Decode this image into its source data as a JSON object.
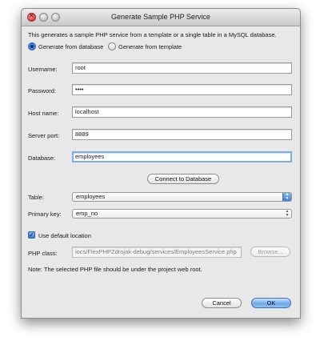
{
  "window": {
    "title": "Generate Sample PHP Service"
  },
  "description": "This generates a sample PHP service from a template or a single table in a MySQL database.",
  "mode": {
    "from_database_label": "Generate from database",
    "from_template_label": "Generate from template",
    "selected": "from_database"
  },
  "form": {
    "username_label": "Username:",
    "username_value": "root",
    "password_label": "Password:",
    "password_value": "••••",
    "host_label": "Host name:",
    "host_value": "localhost",
    "port_label": "Server port:",
    "port_value": "8889",
    "database_label": "Database:",
    "database_value": "employees"
  },
  "connect_button": "Connect to Database",
  "table": {
    "label": "Table:",
    "value": "employees"
  },
  "primary_key": {
    "label": "Primary key:",
    "value": "emp_no"
  },
  "location": {
    "checkbox_label": "Use default location",
    "checked": true,
    "php_class_label": "PHP class:",
    "php_class_value": "iocs/FlexPHPZdrojak-debug/services/EmployeesService.php",
    "browse_label": "Browse..."
  },
  "note": "Note: The selected PHP file should be under the project web root.",
  "footer": {
    "cancel_label": "Cancel",
    "ok_label": "OK"
  }
}
